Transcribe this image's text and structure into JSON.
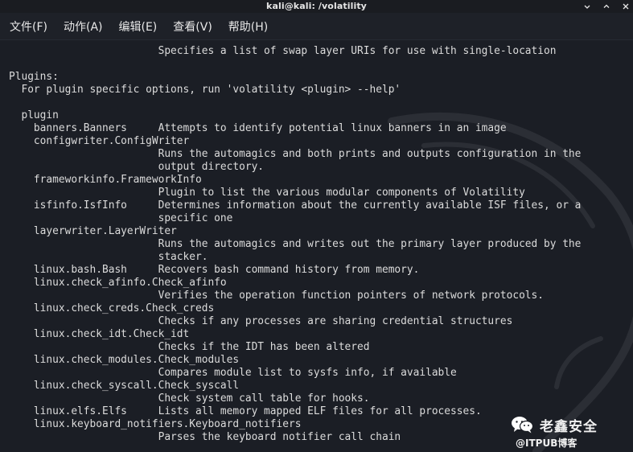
{
  "window": {
    "title": "kali@kali: /volatility"
  },
  "menubar": {
    "items": [
      "文件(F)",
      "动作(A)",
      "编辑(E)",
      "查看(V)",
      "帮助(H)"
    ]
  },
  "terminal": {
    "lines": [
      "                        Specifies a list of swap layer URIs for use with single-location",
      "",
      "Plugins:",
      "  For plugin specific options, run 'volatility <plugin> --help'",
      "",
      "  plugin",
      "    banners.Banners     Attempts to identify potential linux banners in an image",
      "    configwriter.ConfigWriter",
      "                        Runs the automagics and both prints and outputs configuration in the",
      "                        output directory.",
      "    frameworkinfo.FrameworkInfo",
      "                        Plugin to list the various modular components of Volatility",
      "    isfinfo.IsfInfo     Determines information about the currently available ISF files, or a",
      "                        specific one",
      "    layerwriter.LayerWriter",
      "                        Runs the automagics and writes out the primary layer produced by the",
      "                        stacker.",
      "    linux.bash.Bash     Recovers bash command history from memory.",
      "    linux.check_afinfo.Check_afinfo",
      "                        Verifies the operation function pointers of network protocols.",
      "    linux.check_creds.Check_creds",
      "                        Checks if any processes are sharing credential structures",
      "    linux.check_idt.Check_idt",
      "                        Checks if the IDT has been altered",
      "    linux.check_modules.Check_modules",
      "                        Compares module list to sysfs info, if available",
      "    linux.check_syscall.Check_syscall",
      "                        Check system call table for hooks.",
      "    linux.elfs.Elfs     Lists all memory mapped ELF files for all processes.",
      "    linux.keyboard_notifiers.Keyboard_notifiers",
      "                        Parses the keyboard notifier call chain"
    ]
  },
  "watermark": {
    "name": "老鑫安全",
    "sub": "@ITPUB博客",
    "icon": "wechat-icon"
  },
  "colors": {
    "background": "#1b1e25",
    "text": "#dcdcdc",
    "menu_text": "#e8e8e8"
  }
}
